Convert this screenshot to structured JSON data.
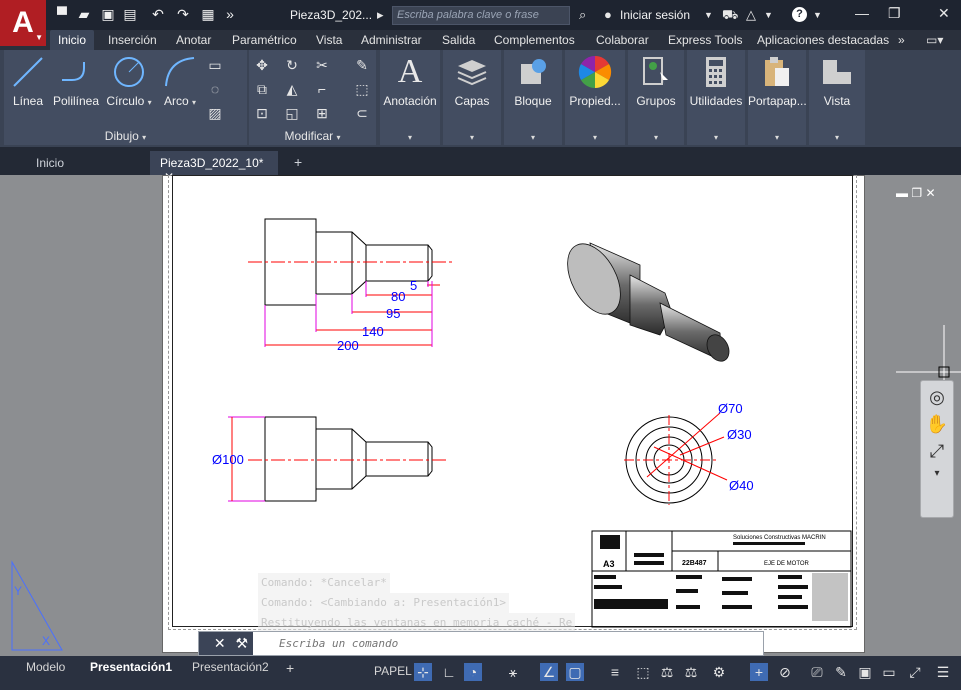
{
  "app": {
    "logo_letter": "A",
    "doc_title": "Pieza3D_202...",
    "search_placeholder": "Escriba palabra clave o frase",
    "login_label": "Iniciar sesión"
  },
  "ribbon_tabs": [
    "Inicio",
    "Inserción",
    "Anotar",
    "Paramétrico",
    "Vista",
    "Administrar",
    "Salida",
    "Complementos",
    "Colaborar",
    "Express Tools",
    "Aplicaciones destacadas"
  ],
  "ribbon": {
    "draw_tools": [
      "Línea",
      "Polilínea",
      "Círculo",
      "Arco"
    ],
    "draw_panel": "Dibujo",
    "modify_panel": "Modificar",
    "big_buttons": [
      "Anotación",
      "Capas",
      "Bloque",
      "Propied...",
      "Grupos",
      "Utilidades",
      "Portapap...",
      "Vista"
    ]
  },
  "doc_tabs": [
    "Inicio",
    "Pieza3D_2022_10*"
  ],
  "drawing": {
    "dims_top": [
      "5",
      "80",
      "95",
      "140",
      "200"
    ],
    "dim_left": "Ø100",
    "dims_circle": [
      "Ø70",
      "Ø30",
      "Ø40"
    ],
    "title_block": {
      "company": "Soluciones Constructivas MACRIN",
      "code": "22B487",
      "part": "EJE DE MOTOR",
      "sheet": "A3"
    }
  },
  "cmd": {
    "history": [
      "Comando: *Cancelar*",
      "Comando:  <Cambiando a: Presentación1>",
      "Restituyendo las ventanas en memoria caché - Re"
    ],
    "placeholder": "Escriba un comando"
  },
  "status": {
    "layout_tabs": [
      "Modelo",
      "Presentación1",
      "Presentación2"
    ],
    "space_label": "PAPEL"
  },
  "colors": {
    "accent_red": "#b01e23",
    "dimension_blue": "#0000ff",
    "center_red": "#ff0000",
    "dim_magenta": "#e000e0"
  }
}
